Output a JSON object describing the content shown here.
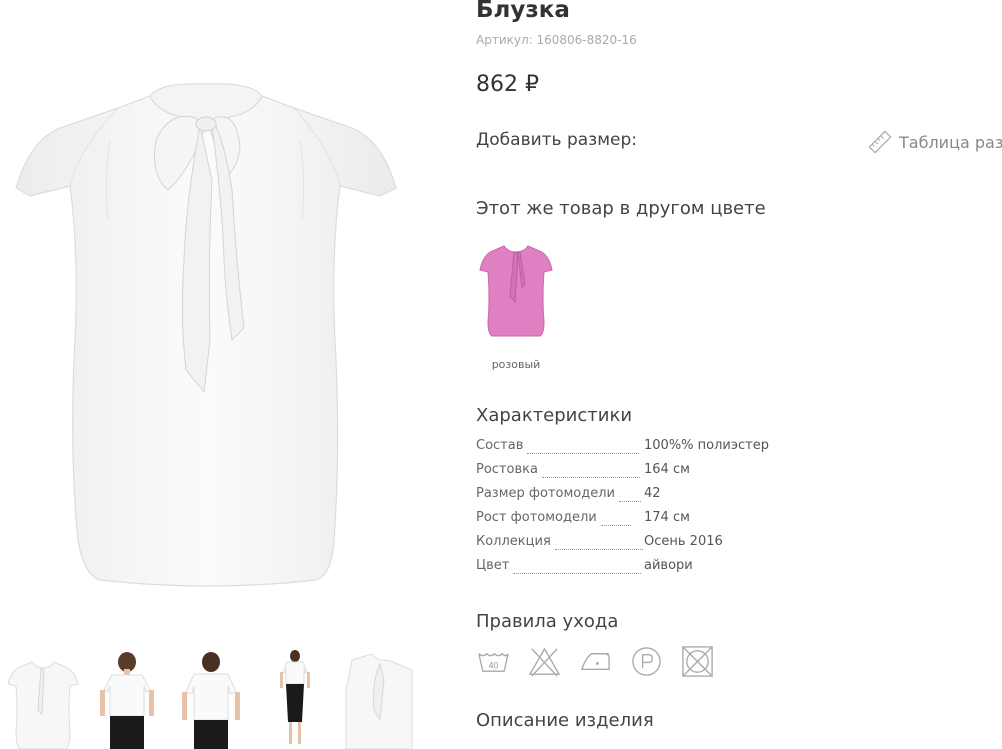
{
  "product": {
    "title": "Блузка",
    "sku": "Артикул: 160806-8820-16",
    "price": "862 ₽"
  },
  "size": {
    "add_label": "Добавить размер:",
    "table_label": "Таблица разм"
  },
  "colors": {
    "heading": "Этот же товар в другом цвете",
    "items": [
      {
        "label": "розовый",
        "color": "#e07fc2"
      }
    ]
  },
  "specs": {
    "heading": "Характеристики",
    "rows": [
      {
        "name": "Состав",
        "value": "100%% полиэстер"
      },
      {
        "name": "Ростовка",
        "value": "164 см"
      },
      {
        "name": "Размер фотомодели",
        "value": "42"
      },
      {
        "name": "Рост фотомодели",
        "value": "174 см"
      },
      {
        "name": "Коллекция",
        "value": "Осень 2016"
      },
      {
        "name": "Цвет",
        "value": "айвори"
      }
    ]
  },
  "care": {
    "heading": "Правила ухода",
    "wash_temp": "40",
    "icons": [
      "wash-40-icon",
      "no-bleach-icon",
      "iron-low-icon",
      "dry-clean-p-icon",
      "no-tumble-dry-icon"
    ]
  },
  "description": {
    "heading": "Описание изделия"
  },
  "theme": {
    "blouse_color": "#f6f6f6",
    "pink": "#e07fc2",
    "text": "#333333",
    "muted": "#aaaaaa"
  }
}
